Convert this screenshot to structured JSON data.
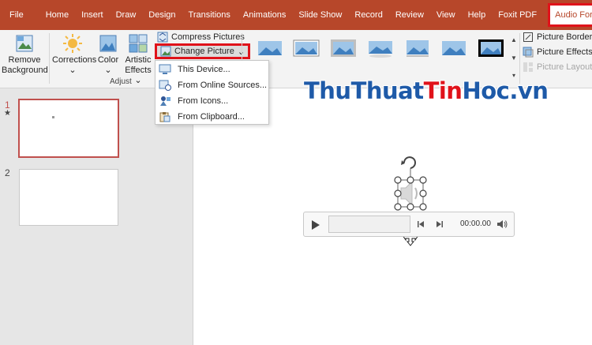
{
  "tabs": [
    "File",
    "Home",
    "Insert",
    "Draw",
    "Design",
    "Transitions",
    "Animations",
    "Slide Show",
    "Record",
    "Review",
    "View",
    "Help",
    "Foxit PDF"
  ],
  "active_tab": "Audio Format",
  "ribbon": {
    "remove_bg": {
      "line1": "Remove",
      "line2": "Background"
    },
    "corrections": "Corrections",
    "color": "Color",
    "artistic": {
      "line1": "Artistic",
      "line2": "Effects"
    },
    "compress": "Compress Pictures",
    "change_picture": "Change Picture",
    "adjust_label": "Adjust",
    "picture_border": "Picture Border",
    "picture_effects": "Picture Effects",
    "picture_layout": "Picture Layout"
  },
  "dropdown": {
    "items": [
      "This Device...",
      "From Online Sources...",
      "From Icons...",
      "From Clipboard..."
    ]
  },
  "slides": {
    "num1": "1",
    "star": "★",
    "num2": "2"
  },
  "watermark": {
    "part1": "ThuThuat",
    "part2": "Tin",
    "part3": "Hoc.vn"
  },
  "player": {
    "time": "00:00.00"
  },
  "colors": {
    "accent": "#b7472a",
    "highlight": "#e0121a",
    "watermark": "#1e5aa8"
  }
}
